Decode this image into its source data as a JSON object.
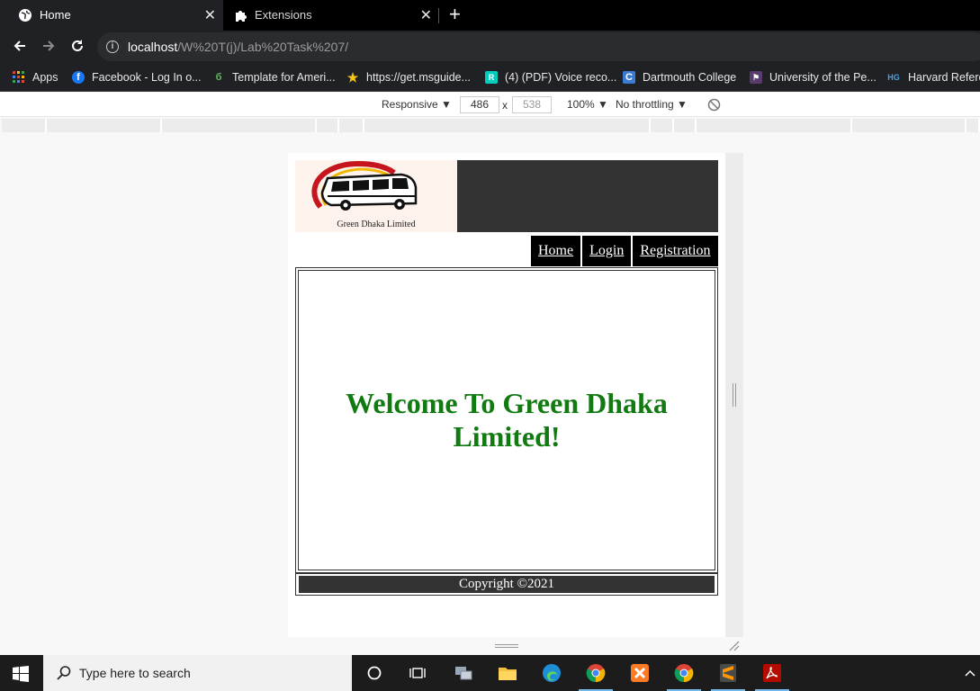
{
  "browser": {
    "tabs": [
      {
        "label": "Home",
        "icon": "globe-icon",
        "active": true
      },
      {
        "label": "Extensions",
        "icon": "puzzle-icon",
        "active": false
      }
    ],
    "new_tab": "+",
    "close_glyph": "✕",
    "url_host": "localhost",
    "url_path": "/W%20T(j)/Lab%20Task%207/",
    "bookmarks": [
      {
        "label": "Apps",
        "icon": "apps-grid-icon"
      },
      {
        "label": "Facebook - Log In o...",
        "icon": "facebook-icon"
      },
      {
        "label": "Template for Ameri...",
        "icon": "leaf-icon"
      },
      {
        "label": "https://get.msguide...",
        "icon": "star-icon"
      },
      {
        "label": "(4) (PDF) Voice reco...",
        "icon": "researchgate-icon"
      },
      {
        "label": "Dartmouth College",
        "icon": "c-icon"
      },
      {
        "label": "University of the Pe...",
        "icon": "university-icon"
      },
      {
        "label": "Harvard Refere",
        "icon": "hg-icon"
      }
    ]
  },
  "devtools": {
    "device": "Responsive ▼",
    "width": "486",
    "times": "x",
    "height": "538",
    "zoom": "100% ▼",
    "throttle": "No throttling ▼"
  },
  "page": {
    "logo_caption": "Green Dhaka Limited",
    "nav": [
      "Home",
      "Login",
      "Registration"
    ],
    "welcome": "Welcome To Green Dhaka Limited!",
    "footer": "Copyright ©2021"
  },
  "taskbar": {
    "search_placeholder": "Type here to search"
  },
  "colors": {
    "welcome_green": "#117a11",
    "header_dark": "#333333"
  }
}
